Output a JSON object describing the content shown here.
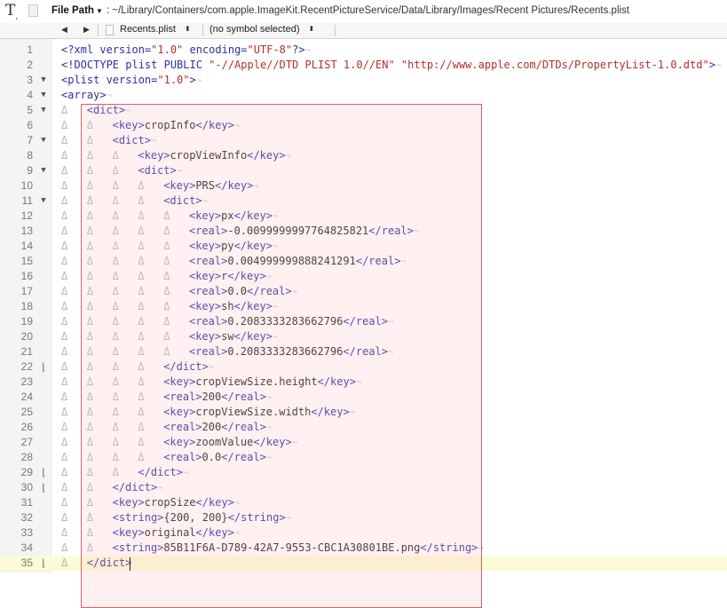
{
  "toolbar": {
    "tool_icon_text": "T",
    "path_label": "File Path",
    "path_value": ": ~/Library/Containers/com.apple.ImageKit.RecentPictureService/Data/Library/Images/Recent Pictures/Recents.plist"
  },
  "jumpbar": {
    "back_icon": "◀",
    "forward_icon": "▶",
    "file_name": "Recents.plist",
    "symbol": "(no symbol selected)",
    "arrows": "⬍"
  },
  "icons": {
    "fold_open": "▼",
    "fold_end": "⌊",
    "tab_marker": "Δ",
    "eol_marker": "¬"
  },
  "colors": {
    "tag": "#2e2ea6",
    "string_value": "#b0302a",
    "highlight_border": "#e06060",
    "current_line": "#fdfbd6"
  },
  "editor": {
    "lines": [
      {
        "num": "1",
        "fold": "",
        "code": "<?xml version=\"1.0\" encoding=\"UTF-8\"?>"
      },
      {
        "num": "2",
        "fold": "",
        "code": "<!DOCTYPE plist PUBLIC \"-//Apple//DTD PLIST 1.0//EN\" \"http://www.apple.com/DTDs/PropertyList-1.0.dtd\">"
      },
      {
        "num": "3",
        "fold": "open",
        "code": "<plist version=\"1.0\">"
      },
      {
        "num": "4",
        "fold": "open",
        "code": "<array>"
      },
      {
        "num": "5",
        "fold": "open",
        "code": "\t<dict>"
      },
      {
        "num": "6",
        "fold": "",
        "code": "\t\t<key>cropInfo</key>"
      },
      {
        "num": "7",
        "fold": "open",
        "code": "\t\t<dict>"
      },
      {
        "num": "8",
        "fold": "",
        "code": "\t\t\t<key>cropViewInfo</key>"
      },
      {
        "num": "9",
        "fold": "open",
        "code": "\t\t\t<dict>"
      },
      {
        "num": "10",
        "fold": "",
        "code": "\t\t\t\t<key>PRS</key>"
      },
      {
        "num": "11",
        "fold": "open",
        "code": "\t\t\t\t<dict>"
      },
      {
        "num": "12",
        "fold": "",
        "code": "\t\t\t\t\t<key>px</key>"
      },
      {
        "num": "13",
        "fold": "",
        "code": "\t\t\t\t\t<real>-0.0099999997764825821</real>"
      },
      {
        "num": "14",
        "fold": "",
        "code": "\t\t\t\t\t<key>py</key>"
      },
      {
        "num": "15",
        "fold": "",
        "code": "\t\t\t\t\t<real>0.004999999888241291</real>"
      },
      {
        "num": "16",
        "fold": "",
        "code": "\t\t\t\t\t<key>r</key>"
      },
      {
        "num": "17",
        "fold": "",
        "code": "\t\t\t\t\t<real>0.0</real>"
      },
      {
        "num": "18",
        "fold": "",
        "code": "\t\t\t\t\t<key>sh</key>"
      },
      {
        "num": "19",
        "fold": "",
        "code": "\t\t\t\t\t<real>0.2083333283662796</real>"
      },
      {
        "num": "20",
        "fold": "",
        "code": "\t\t\t\t\t<key>sw</key>"
      },
      {
        "num": "21",
        "fold": "",
        "code": "\t\t\t\t\t<real>0.2083333283662796</real>"
      },
      {
        "num": "22",
        "fold": "end",
        "code": "\t\t\t\t</dict>"
      },
      {
        "num": "23",
        "fold": "",
        "code": "\t\t\t\t<key>cropViewSize.height</key>"
      },
      {
        "num": "24",
        "fold": "",
        "code": "\t\t\t\t<real>200</real>"
      },
      {
        "num": "25",
        "fold": "",
        "code": "\t\t\t\t<key>cropViewSize.width</key>"
      },
      {
        "num": "26",
        "fold": "",
        "code": "\t\t\t\t<real>200</real>"
      },
      {
        "num": "27",
        "fold": "",
        "code": "\t\t\t\t<key>zoomValue</key>"
      },
      {
        "num": "28",
        "fold": "",
        "code": "\t\t\t\t<real>0.0</real>"
      },
      {
        "num": "29",
        "fold": "end",
        "code": "\t\t\t</dict>"
      },
      {
        "num": "30",
        "fold": "end",
        "code": "\t\t</dict>"
      },
      {
        "num": "31",
        "fold": "",
        "code": "\t\t<key>cropSize</key>"
      },
      {
        "num": "32",
        "fold": "",
        "code": "\t\t<string>{200, 200}</string>"
      },
      {
        "num": "33",
        "fold": "",
        "code": "\t\t<key>original</key>"
      },
      {
        "num": "34",
        "fold": "",
        "code": "\t\t<string>85B11F6A-D789-42A7-9553-CBC1A30801BE.png</string>"
      },
      {
        "num": "35",
        "fold": "end",
        "code": "\t</dict>",
        "current": true,
        "no_eol": true
      }
    ]
  }
}
